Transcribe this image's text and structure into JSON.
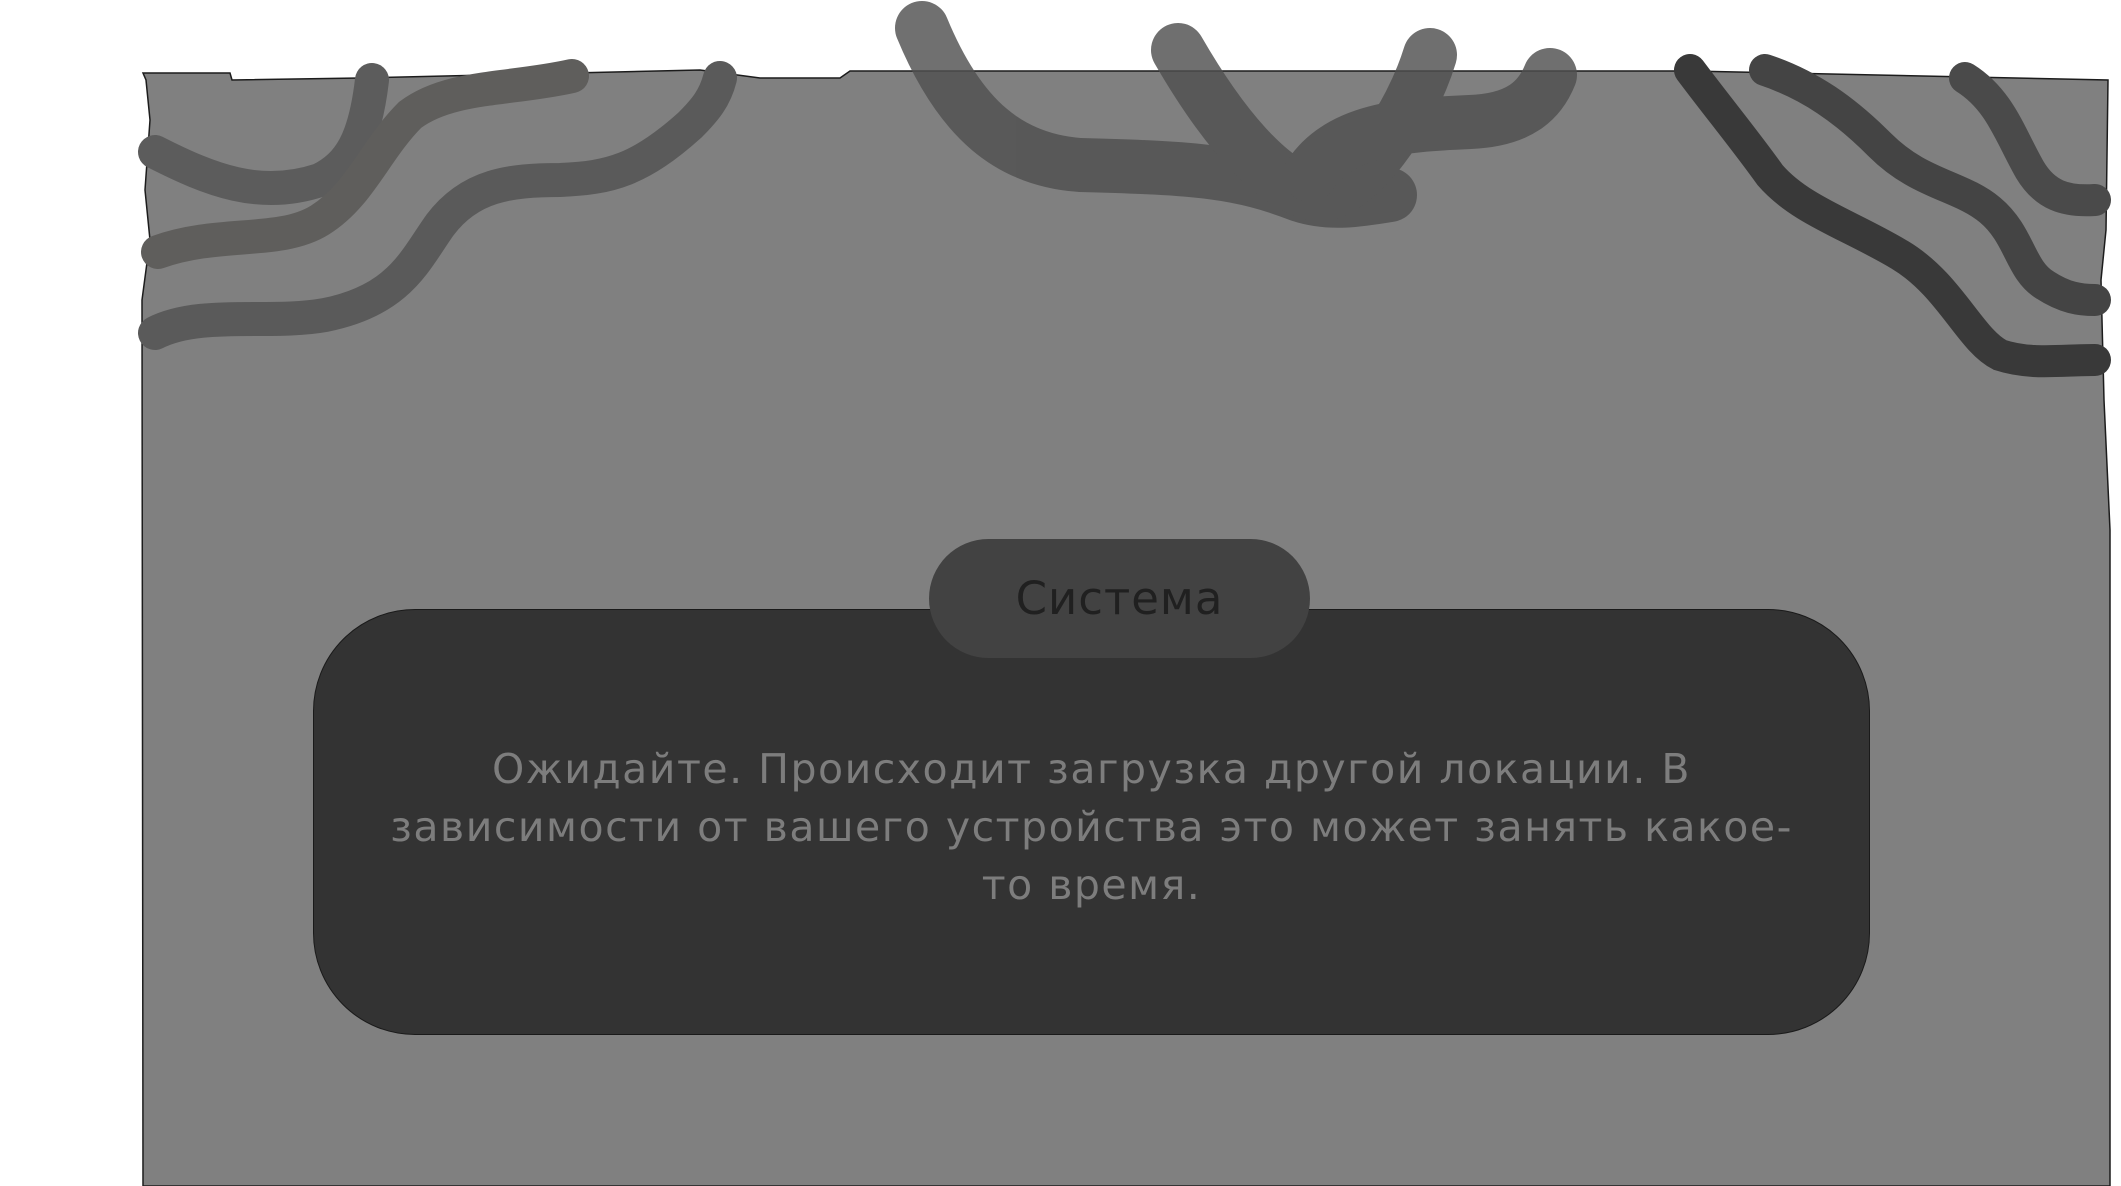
{
  "scene": {
    "background_color": "#808080",
    "scribble_color": "#555555"
  },
  "dialog": {
    "speaker": "Система",
    "message": "Ожидайте. Происходит загрузка другой локации. В зависимости от вашего устройства это может занять какое-то время.",
    "box_color": "#333333",
    "tab_color": "#424242",
    "text_color": "#7d7d7d"
  }
}
